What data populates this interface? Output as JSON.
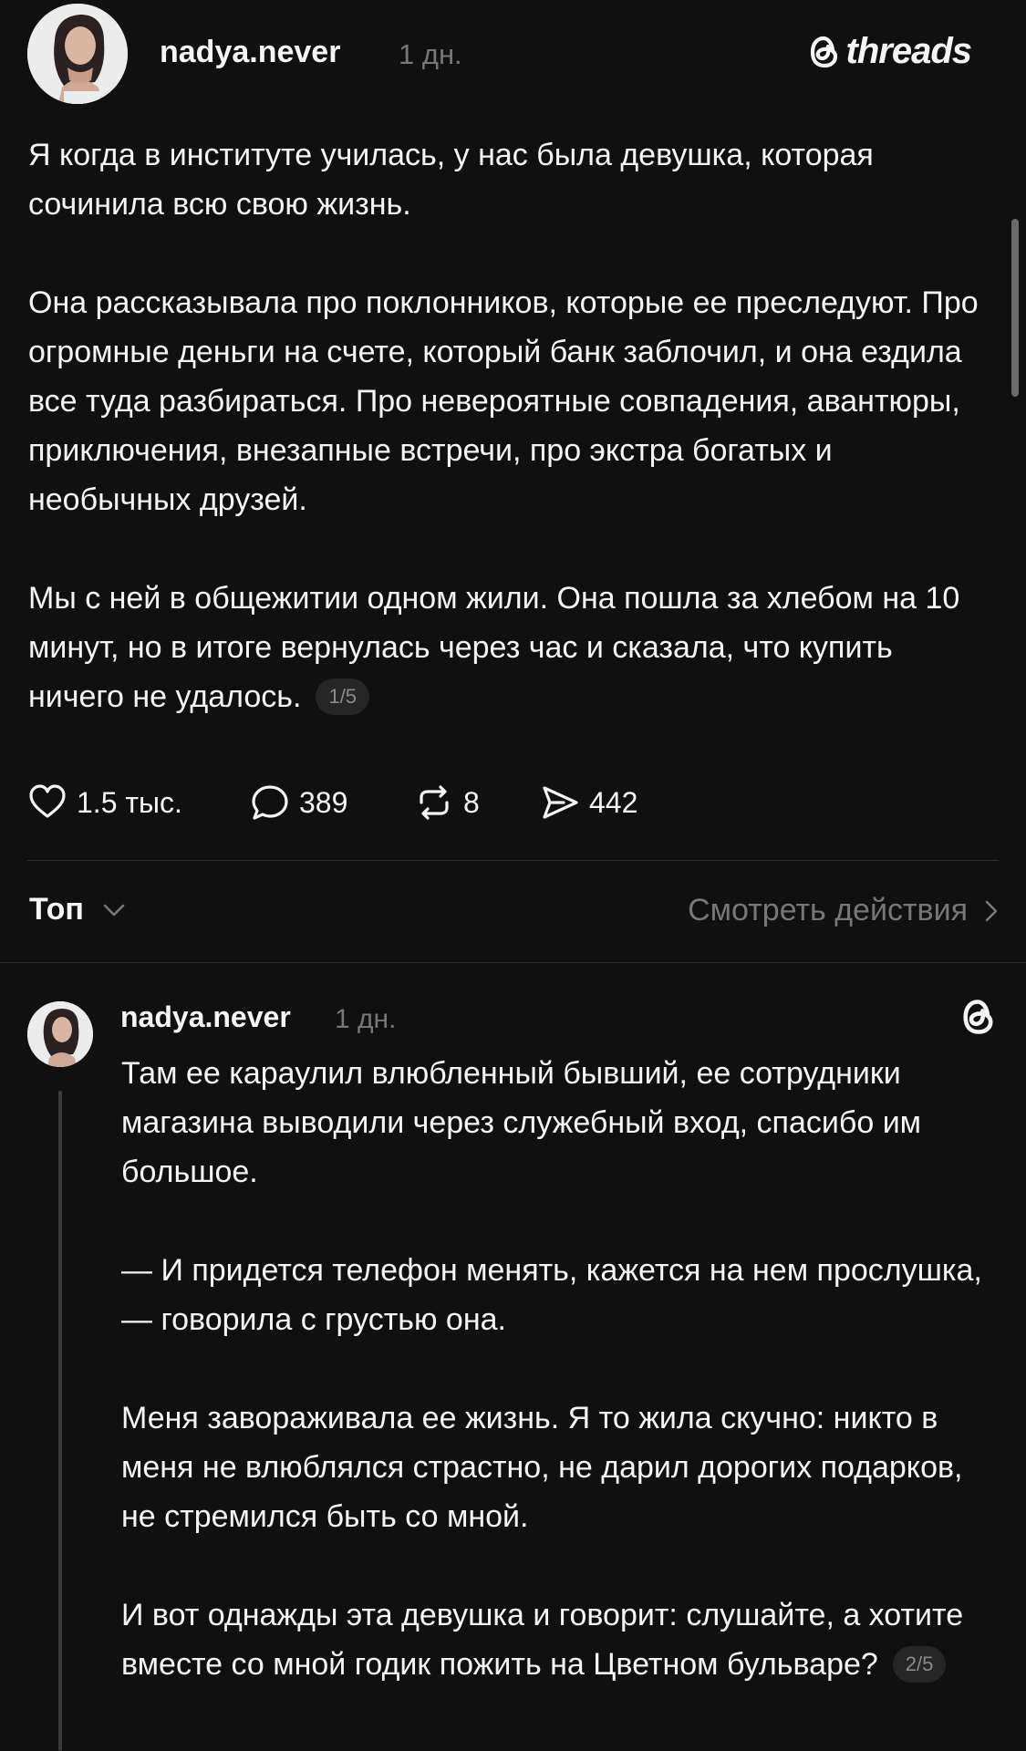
{
  "post": {
    "username": "nadya.never",
    "time": "1 дн.",
    "brand": "threads",
    "paragraphs": [
      "Я когда в институте училась, у нас была девушка, которая сочинила всю свою жизнь.",
      "Она рассказывала про поклонников, которые ее преследуют. Про огромные деньги на счете, который банк заблочил, и она ездила все туда разбираться. Про невероятные совпадения, авантюры, приключения, внезапные встречи, про экстра богатых и необычных друзей.",
      "Мы с ней в общежитии одном жили. Она пошла за хлебом на 10 минут, но в итоге вернулась через час и сказала, что купить ничего не удалось."
    ],
    "counter": "1/5",
    "actions": {
      "likes": "1.5 тыс.",
      "comments": "389",
      "reposts": "8",
      "shares": "442"
    }
  },
  "sort": {
    "label": "Топ",
    "activity_link": "Смотреть действия"
  },
  "reply": {
    "username": "nadya.never",
    "time": "1 дн.",
    "paragraphs": [
      "Там ее караулил влюбленный бывший, ее сотрудники магазина выводили через служебный вход, спасибо им большое.",
      "— И придется телефон менять, кажется на нем прослушка, — говорила с грустью она.",
      "Меня завораживала ее жизнь. Я то жила скучно: никто в меня не влюблялся страстно, не дарил дорогих подарков, не стремился быть со мной.",
      "И вот однажды эта девушка и говорит: слушайте, а хотите вместе со мной годик пожить на Цветном бульваре?"
    ],
    "counter": "2/5"
  },
  "icons": {
    "like": "heart-icon",
    "comment": "comment-bubble-icon",
    "repost": "repost-icon",
    "share": "send-icon",
    "brand": "threads-logo-icon",
    "sort": "chevron-down-icon",
    "activity": "chevron-right-icon"
  },
  "colors": {
    "background": "#101010",
    "text": "#f3f5f7",
    "muted": "#777777",
    "divider": "#2e2e2e"
  }
}
